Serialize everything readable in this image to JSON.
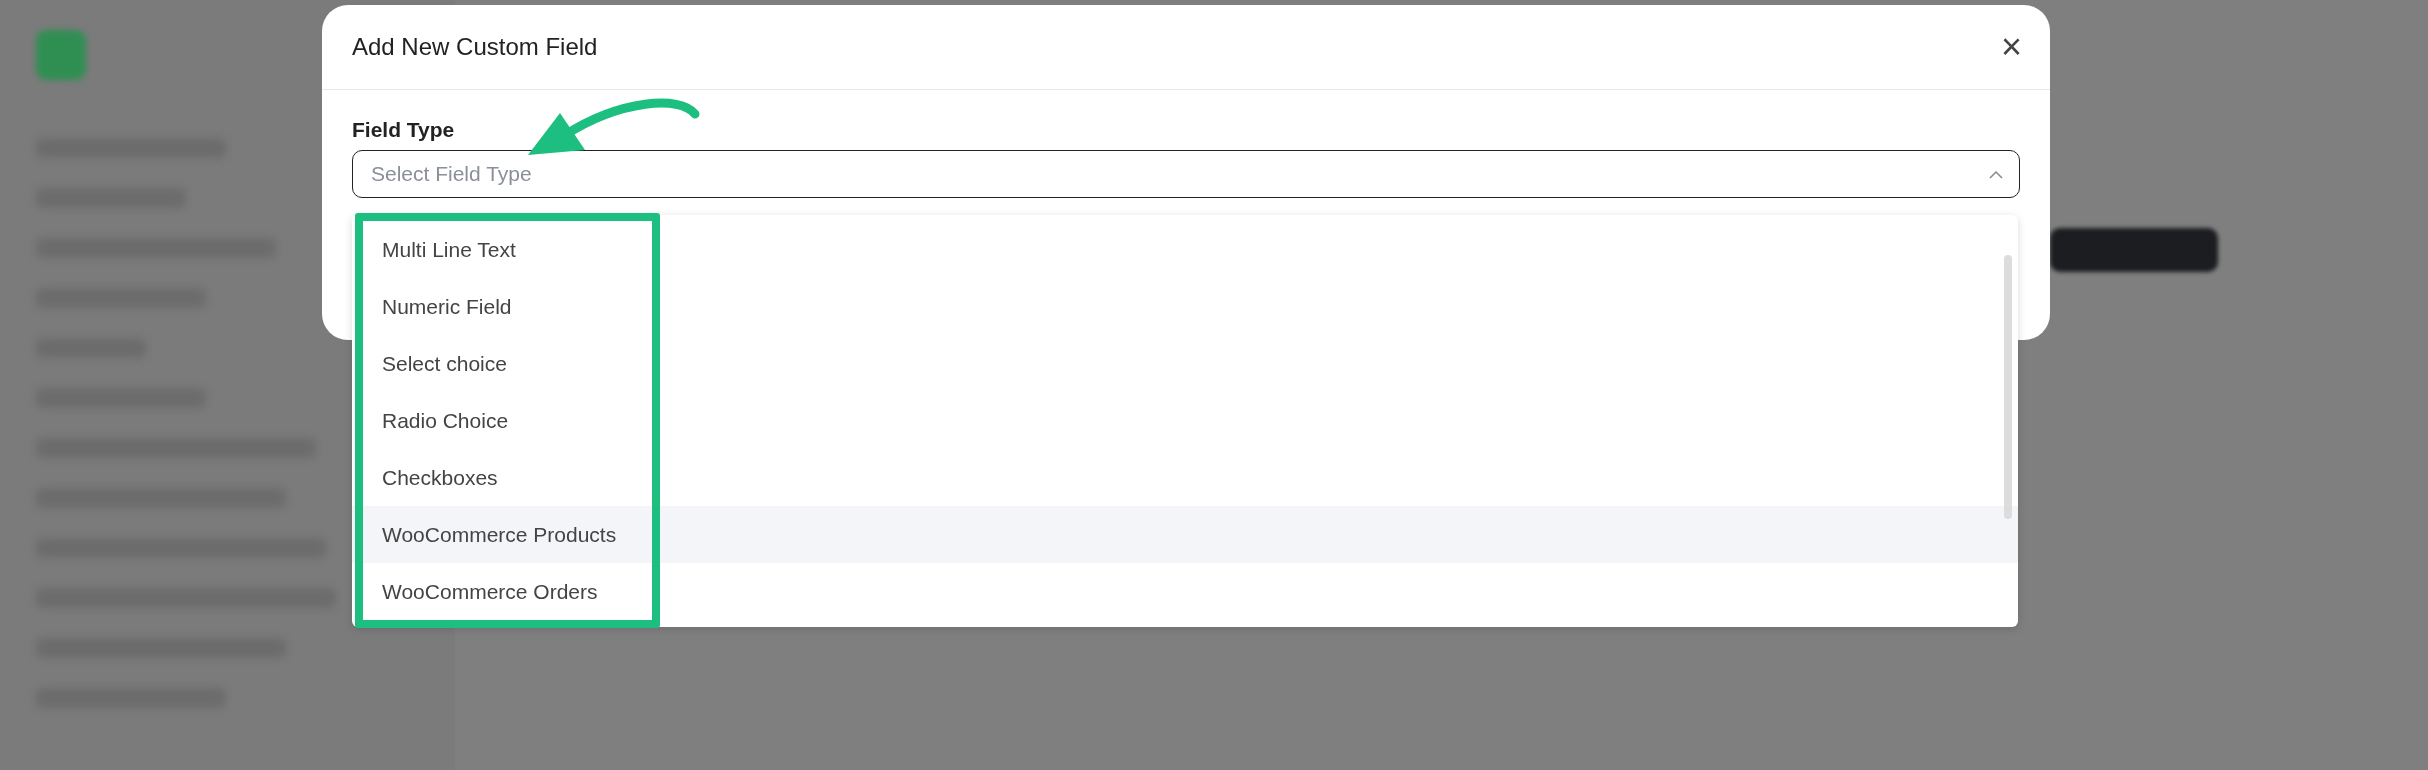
{
  "dialog": {
    "title": "Add New Custom Field",
    "close_icon": "×"
  },
  "field": {
    "label": "Field Type",
    "placeholder": "Select Field Type",
    "expanded": true
  },
  "options": [
    {
      "label": "Multi Line Text",
      "selected": false
    },
    {
      "label": "Numeric Field",
      "selected": false
    },
    {
      "label": "Select choice",
      "selected": false
    },
    {
      "label": "Radio Choice",
      "selected": false
    },
    {
      "label": "Checkboxes",
      "selected": false
    },
    {
      "label": "WooCommerce Products",
      "selected": true
    },
    {
      "label": "WooCommerce Orders",
      "selected": false
    }
  ]
}
